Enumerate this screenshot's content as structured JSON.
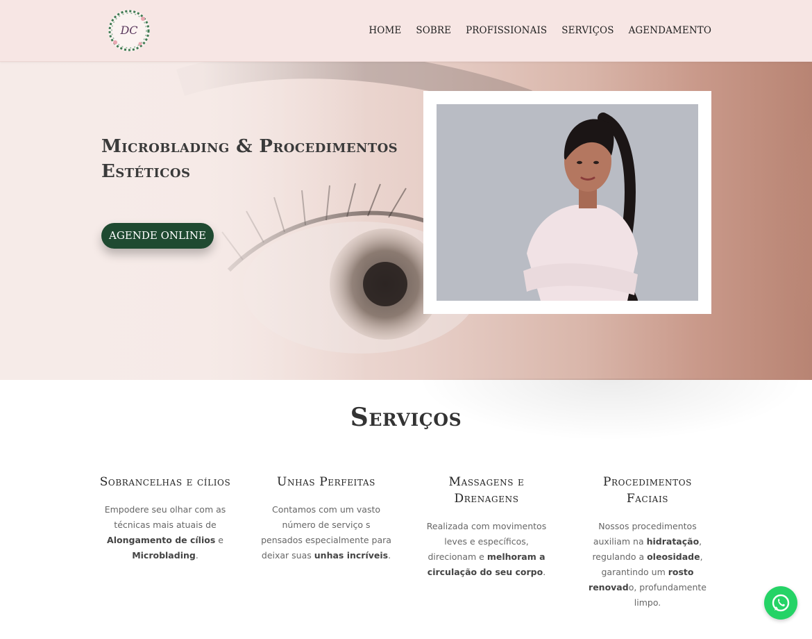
{
  "nav": {
    "items": [
      {
        "label": "HOME"
      },
      {
        "label": "SOBRE"
      },
      {
        "label": "PROFISSIONAIS"
      },
      {
        "label": "SERVIÇOS"
      },
      {
        "label": "AGENDAMENTO"
      }
    ]
  },
  "logo": {
    "text": "DC"
  },
  "hero": {
    "title": "Microblading & Procedimentos Estéticos",
    "cta": "AGENDE ONLINE"
  },
  "services": {
    "title": "Serviços",
    "items": [
      {
        "title": "Sobrancelhas e cílios",
        "parts": [
          "Empodere seu olhar com as técnicas mais atuais de ",
          "Alongamento de cílios",
          " e ",
          "Microblading",
          "."
        ]
      },
      {
        "title": "Unhas Perfeitas",
        "parts": [
          "Contamos com um vasto número de serviço s pensados especialmente para deixar suas ",
          "unhas incríveis",
          "."
        ]
      },
      {
        "title": "Massagens e Drenagens",
        "parts": [
          "Realizada com movimentos leves e específicos, direcionam e ",
          "melhoram a circulação do seu corpo",
          "."
        ]
      },
      {
        "title": "Procedimentos Faciais",
        "parts": [
          "Nossos procedimentos auxiliam na ",
          "hidratação",
          ", regulando a ",
          "oleosidade",
          ", garantindo um ",
          "rosto renovad",
          "o, profundamente limpo."
        ]
      }
    ]
  },
  "colors": {
    "header_bg": "#f7e6e4",
    "cta_bg": "#1f4a31",
    "whatsapp": "#25d366"
  },
  "icons": {
    "whatsapp": "whatsapp-icon"
  }
}
